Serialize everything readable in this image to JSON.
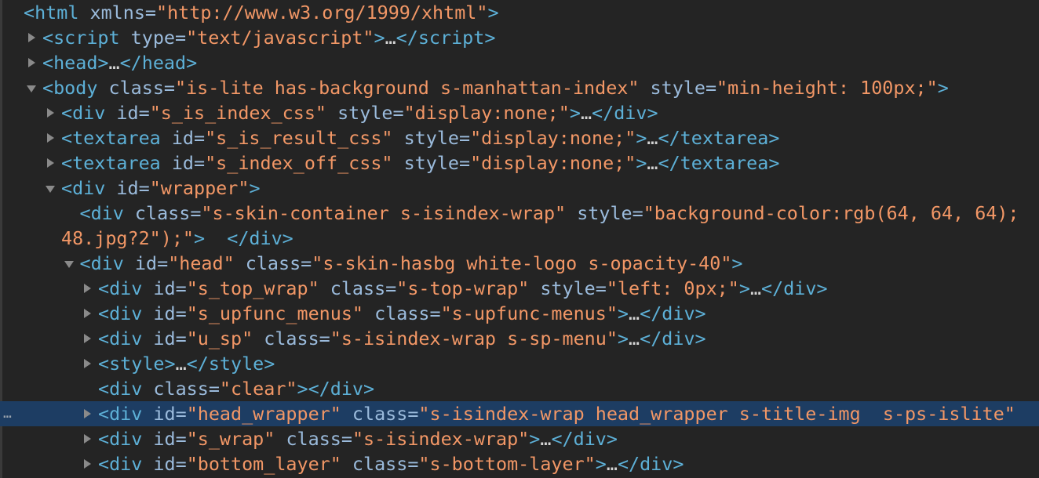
{
  "panel": "elements-dom-tree",
  "colors": {
    "background": "#242424",
    "tag": "#5db0d7",
    "attribute_name": "#9bbbdc",
    "attribute_value": "#f29766",
    "selected_row": "#1d3d63"
  },
  "selected_marker": "…",
  "lines": [
    {
      "depth": 0,
      "toggle": "none",
      "tokens": [
        [
          "tag",
          "<html"
        ],
        [
          "attr",
          " xmlns="
        ],
        [
          "val",
          "\"http://www.w3.org/1999/xhtml\""
        ],
        [
          "tag",
          ">"
        ]
      ]
    },
    {
      "depth": 1,
      "toggle": "collapsed",
      "tokens": [
        [
          "tag",
          "<script"
        ],
        [
          "attr",
          " type="
        ],
        [
          "val",
          "\"text/javascript\""
        ],
        [
          "tag",
          ">"
        ],
        [
          "txt",
          "…"
        ],
        [
          "tag",
          "</script>"
        ]
      ]
    },
    {
      "depth": 1,
      "toggle": "collapsed",
      "tokens": [
        [
          "tag",
          "<head>"
        ],
        [
          "txt",
          "…"
        ],
        [
          "tag",
          "</head>"
        ]
      ]
    },
    {
      "depth": 1,
      "toggle": "expanded",
      "tokens": [
        [
          "tag",
          "<body"
        ],
        [
          "attr",
          " class="
        ],
        [
          "val",
          "\"is-lite has-background s-manhattan-index\""
        ],
        [
          "attr",
          " style="
        ],
        [
          "val",
          "\"min-height: 100px;\""
        ],
        [
          "tag",
          ">"
        ]
      ]
    },
    {
      "depth": 2,
      "toggle": "collapsed",
      "tokens": [
        [
          "tag",
          "<div"
        ],
        [
          "attr",
          " id="
        ],
        [
          "val",
          "\"s_is_index_css\""
        ],
        [
          "attr",
          " style="
        ],
        [
          "val",
          "\"display:none;\""
        ],
        [
          "tag",
          ">"
        ],
        [
          "txt",
          "…"
        ],
        [
          "tag",
          "</div>"
        ]
      ]
    },
    {
      "depth": 2,
      "toggle": "collapsed",
      "tokens": [
        [
          "tag",
          "<textarea"
        ],
        [
          "attr",
          " id="
        ],
        [
          "val",
          "\"s_is_result_css\""
        ],
        [
          "attr",
          " style="
        ],
        [
          "val",
          "\"display:none;\""
        ],
        [
          "tag",
          ">"
        ],
        [
          "txt",
          "…"
        ],
        [
          "tag",
          "</textarea>"
        ]
      ]
    },
    {
      "depth": 2,
      "toggle": "collapsed",
      "tokens": [
        [
          "tag",
          "<textarea"
        ],
        [
          "attr",
          " id="
        ],
        [
          "val",
          "\"s_index_off_css\""
        ],
        [
          "attr",
          " style="
        ],
        [
          "val",
          "\"display:none;\""
        ],
        [
          "tag",
          ">"
        ],
        [
          "txt",
          "…"
        ],
        [
          "tag",
          "</textarea>"
        ]
      ]
    },
    {
      "depth": 2,
      "toggle": "expanded",
      "tokens": [
        [
          "tag",
          "<div"
        ],
        [
          "attr",
          " id="
        ],
        [
          "val",
          "\"wrapper\""
        ],
        [
          "tag",
          ">"
        ]
      ]
    },
    {
      "depth": 3,
      "toggle": "none",
      "tokens": [
        [
          "tag",
          "<div"
        ],
        [
          "attr",
          " class="
        ],
        [
          "val",
          "\"s-skin-container s-isindex-wrap\""
        ],
        [
          "attr",
          " style="
        ],
        [
          "val",
          "\"background-color:rgb(64, 64, 64);"
        ]
      ]
    },
    {
      "depth": 2,
      "toggle": "none",
      "continuation": true,
      "tokens": [
        [
          "val",
          "48.jpg?2\");\""
        ],
        [
          "tag",
          ">"
        ],
        [
          "txt",
          "  "
        ],
        [
          "tag",
          "</div>"
        ]
      ]
    },
    {
      "depth": 3,
      "toggle": "expanded",
      "tokens": [
        [
          "tag",
          "<div"
        ],
        [
          "attr",
          " id="
        ],
        [
          "val",
          "\"head\""
        ],
        [
          "attr",
          " class="
        ],
        [
          "val",
          "\"s-skin-hasbg white-logo s-opacity-40\""
        ],
        [
          "tag",
          ">"
        ]
      ]
    },
    {
      "depth": 4,
      "toggle": "collapsed",
      "tokens": [
        [
          "tag",
          "<div"
        ],
        [
          "attr",
          " id="
        ],
        [
          "val",
          "\"s_top_wrap\""
        ],
        [
          "attr",
          " class="
        ],
        [
          "val",
          "\"s-top-wrap\""
        ],
        [
          "attr",
          " style="
        ],
        [
          "val",
          "\"left: 0px;\""
        ],
        [
          "tag",
          ">"
        ],
        [
          "txt",
          "…"
        ],
        [
          "tag",
          "</div>"
        ]
      ]
    },
    {
      "depth": 4,
      "toggle": "collapsed",
      "tokens": [
        [
          "tag",
          "<div"
        ],
        [
          "attr",
          " id="
        ],
        [
          "val",
          "\"s_upfunc_menus\""
        ],
        [
          "attr",
          " class="
        ],
        [
          "val",
          "\"s-upfunc-menus\""
        ],
        [
          "tag",
          ">"
        ],
        [
          "txt",
          "…"
        ],
        [
          "tag",
          "</div>"
        ]
      ]
    },
    {
      "depth": 4,
      "toggle": "collapsed",
      "tokens": [
        [
          "tag",
          "<div"
        ],
        [
          "attr",
          " id="
        ],
        [
          "val",
          "\"u_sp\""
        ],
        [
          "attr",
          " class="
        ],
        [
          "val",
          "\"s-isindex-wrap s-sp-menu\""
        ],
        [
          "tag",
          ">"
        ],
        [
          "txt",
          "…"
        ],
        [
          "tag",
          "</div>"
        ]
      ]
    },
    {
      "depth": 4,
      "toggle": "collapsed",
      "tokens": [
        [
          "tag",
          "<style>"
        ],
        [
          "txt",
          "…"
        ],
        [
          "tag",
          "</style>"
        ]
      ]
    },
    {
      "depth": 4,
      "toggle": "none",
      "tokens": [
        [
          "tag",
          "<div"
        ],
        [
          "attr",
          " class="
        ],
        [
          "val",
          "\"clear\""
        ],
        [
          "tag",
          "></div>"
        ]
      ]
    },
    {
      "depth": 4,
      "toggle": "collapsed",
      "selected": true,
      "tokens": [
        [
          "tag",
          "<div"
        ],
        [
          "attr",
          " id="
        ],
        [
          "val",
          "\"head_wrapper\""
        ],
        [
          "attr",
          " class="
        ],
        [
          "val",
          "\"s-isindex-wrap head_wrapper s-title-img  s-ps-islite\""
        ]
      ]
    },
    {
      "depth": 4,
      "toggle": "collapsed",
      "tokens": [
        [
          "tag",
          "<div"
        ],
        [
          "attr",
          " id="
        ],
        [
          "val",
          "\"s_wrap\""
        ],
        [
          "attr",
          " class="
        ],
        [
          "val",
          "\"s-isindex-wrap\""
        ],
        [
          "tag",
          ">"
        ],
        [
          "txt",
          "…"
        ],
        [
          "tag",
          "</div>"
        ]
      ]
    },
    {
      "depth": 4,
      "toggle": "collapsed",
      "tokens": [
        [
          "tag",
          "<div"
        ],
        [
          "attr",
          " id="
        ],
        [
          "val",
          "\"bottom_layer\""
        ],
        [
          "attr",
          " class="
        ],
        [
          "val",
          "\"s-bottom-layer\""
        ],
        [
          "tag",
          ">"
        ],
        [
          "txt",
          "…"
        ],
        [
          "tag",
          "</div>"
        ]
      ]
    }
  ]
}
